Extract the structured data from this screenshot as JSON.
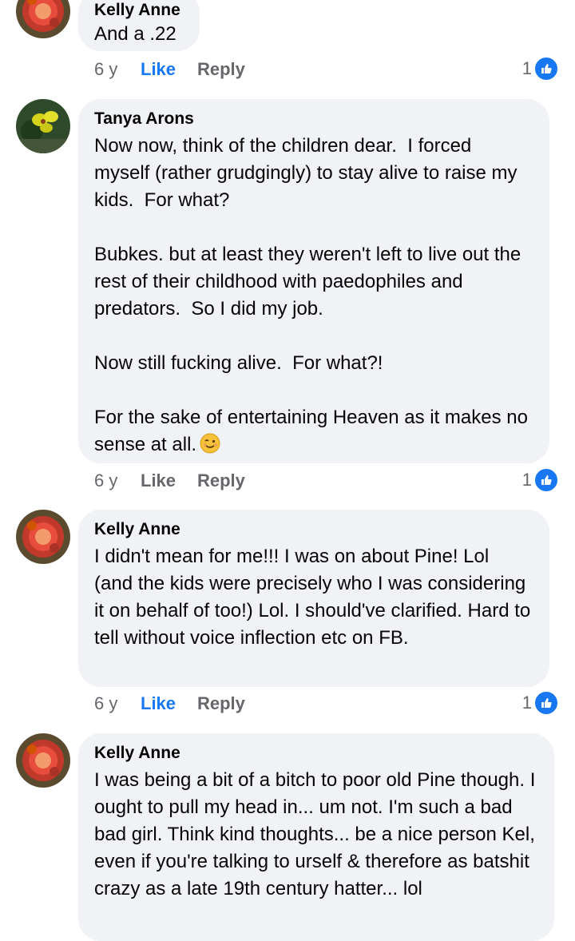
{
  "comments": [
    {
      "author": "Kelly Anne",
      "text": "And a .22",
      "time": "6 y",
      "like_label": "Like",
      "liked": true,
      "reply_label": "Reply",
      "reaction_count": "1",
      "reaction_icon": "thumbs-up-icon"
    },
    {
      "author": "Tanya Arons",
      "text": "Now now, think of the children dear.  I forced myself (rather grudgingly) to stay alive to raise my kids.  For what?\n\nBubkes. but at least they weren't left to live out the rest of their childhood with paedophiles and predators.  So I did my job.\n\nNow still fucking alive.  For what?!\n\nFor the sake of entertaining Heaven as it makes no sense at all.",
      "emoji": "winking-face-icon",
      "time": "6 y",
      "like_label": "Like",
      "liked": false,
      "reply_label": "Reply",
      "reaction_count": "1",
      "reaction_icon": "thumbs-up-icon"
    },
    {
      "author": "Kelly Anne",
      "text": "I didn't mean for me!!! I was on about Pine! Lol (and the kids were precisely who I was considering it on behalf of too!) Lol. I should've clarified. Hard to tell without voice inflection etc on FB.",
      "time": "6 y",
      "like_label": "Like",
      "liked": true,
      "reply_label": "Reply",
      "reaction_count": "1",
      "reaction_icon": "thumbs-up-icon"
    },
    {
      "author": "Kelly Anne",
      "text": "I was being a bit of a bitch to poor old Pine though. I ought to pull my head in... um not. I'm such a bad bad girl. Think kind thoughts... be a nice person Kel, even if you're talking to urself & therefore as batshit crazy as a late 19th century hatter... lol"
    }
  ],
  "colors": {
    "bubble": "#f0f2f5",
    "like_active": "#1877f2",
    "secondary_text": "#65676b"
  }
}
